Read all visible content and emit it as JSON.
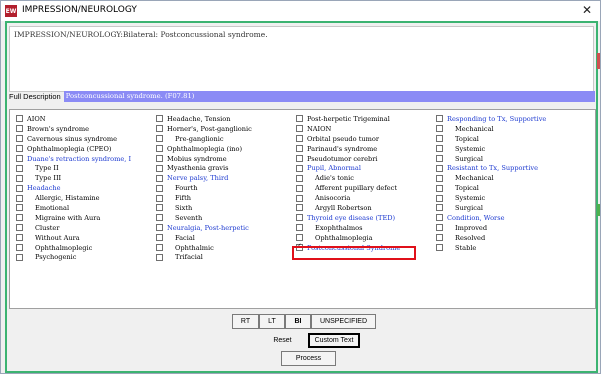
{
  "window": {
    "title": "IMPRESSION/NEUROLOGY",
    "app_icon_text": "EW",
    "close_glyph": "✕"
  },
  "impression_text": "IMPRESSION/NEUROLOGY:Bilateral: Postconcussional syndrome.",
  "full_description": {
    "label": "Full Description",
    "value": "Postconcussional syndrome. (F07.81)"
  },
  "columns": [
    {
      "items": [
        {
          "label": "AION",
          "style": "normal",
          "checked": false
        },
        {
          "label": "Brown's syndrome",
          "style": "normal",
          "checked": false
        },
        {
          "label": "Cavernous sinus syndrome",
          "style": "normal",
          "checked": false
        },
        {
          "label": "Ophthalmoplegia  (CPEO)",
          "style": "normal",
          "checked": false
        },
        {
          "label": "Duane's retraction syndrome, I",
          "style": "blue",
          "checked": false
        },
        {
          "label": "Type II",
          "style": "indent",
          "checked": false
        },
        {
          "label": "Type III",
          "style": "indent",
          "checked": false
        },
        {
          "label": "Headache",
          "style": "blue",
          "checked": false
        },
        {
          "label": "Allergic, Histamine",
          "style": "indent",
          "checked": false
        },
        {
          "label": "Emotional",
          "style": "indent",
          "checked": false
        },
        {
          "label": "Migraine with Aura",
          "style": "indent",
          "checked": false
        },
        {
          "label": "Cluster",
          "style": "indent2",
          "checked": false
        },
        {
          "label": "Without Aura",
          "style": "indent2",
          "checked": false
        },
        {
          "label": "Ophthalmoplegic",
          "style": "indent2",
          "checked": false
        },
        {
          "label": "Psychogenic",
          "style": "indent",
          "checked": false
        }
      ]
    },
    {
      "items": [
        {
          "label": "Headache, Tension",
          "style": "normal",
          "checked": false
        },
        {
          "label": "Horner's, Post-ganglionic",
          "style": "normal",
          "checked": false
        },
        {
          "label": "Pre-ganglionic",
          "style": "indent",
          "checked": false
        },
        {
          "label": "Ophthalmoplegia (ino)",
          "style": "normal",
          "checked": false
        },
        {
          "label": "Mobius syndrome",
          "style": "normal",
          "checked": false
        },
        {
          "label": "Myasthenia gravis",
          "style": "normal",
          "checked": false
        },
        {
          "label": "Nerve palsy, Third",
          "style": "blue",
          "checked": false
        },
        {
          "label": "Fourth",
          "style": "indent",
          "checked": false
        },
        {
          "label": "Fifth",
          "style": "indent",
          "checked": false
        },
        {
          "label": "Sixth",
          "style": "indent",
          "checked": false
        },
        {
          "label": "Seventh",
          "style": "indent",
          "checked": false
        },
        {
          "label": "Neuralgia, Post-herpetic",
          "style": "blue",
          "checked": false
        },
        {
          "label": "Facial",
          "style": "indent",
          "checked": false
        },
        {
          "label": "Ophthalmic",
          "style": "indent",
          "checked": false
        },
        {
          "label": "Trifacial",
          "style": "indent",
          "checked": false
        }
      ]
    },
    {
      "items": [
        {
          "label": "Post-herpetic Trigeminal",
          "style": "normal",
          "checked": false
        },
        {
          "label": "NAION",
          "style": "normal",
          "checked": false
        },
        {
          "label": "Orbital pseudo tumor",
          "style": "normal",
          "checked": false
        },
        {
          "label": "Parinaud's syndrome",
          "style": "normal",
          "checked": false
        },
        {
          "label": "Pseudotumor cerebri",
          "style": "normal",
          "checked": false
        },
        {
          "label": "Pupil, Abnormal",
          "style": "blue",
          "checked": false
        },
        {
          "label": "Adie's tonic",
          "style": "indent",
          "checked": false
        },
        {
          "label": "Afferent pupillary defect",
          "style": "indent",
          "checked": false
        },
        {
          "label": "Anisocoria",
          "style": "indent",
          "checked": false
        },
        {
          "label": "Argyll Robertson",
          "style": "indent",
          "checked": false
        },
        {
          "label": "Thyroid eye disease (TED)",
          "style": "blue",
          "checked": false
        },
        {
          "label": "Exophthalmos",
          "style": "indent",
          "checked": false
        },
        {
          "label": "Ophthalmoplegia",
          "style": "indent",
          "checked": false
        },
        {
          "label": "Postconcussional Syndrome",
          "style": "blue",
          "checked": true
        }
      ]
    },
    {
      "items": [
        {
          "label": "Responding to Tx, Supportive",
          "style": "blue",
          "checked": false
        },
        {
          "label": "Mechanical",
          "style": "indent",
          "checked": false
        },
        {
          "label": "Topical",
          "style": "indent",
          "checked": false
        },
        {
          "label": "Systemic",
          "style": "indent",
          "checked": false
        },
        {
          "label": "Surgical",
          "style": "indent",
          "checked": false
        },
        {
          "label": "Resistant to Tx, Supportive",
          "style": "blue",
          "checked": false
        },
        {
          "label": "Mechanical",
          "style": "indent",
          "checked": false
        },
        {
          "label": "Topical",
          "style": "indent",
          "checked": false
        },
        {
          "label": "Systemic",
          "style": "indent",
          "checked": false
        },
        {
          "label": "Surgical",
          "style": "indent",
          "checked": false
        },
        {
          "label": "Condition, Worse",
          "style": "blue",
          "checked": false
        },
        {
          "label": "Improved",
          "style": "indent",
          "checked": false
        },
        {
          "label": "Resolved",
          "style": "indent",
          "checked": false
        },
        {
          "label": "Stable",
          "style": "indent",
          "checked": false
        }
      ]
    }
  ],
  "laterality_buttons": [
    "RT",
    "LT",
    "BI",
    "UNSPECIFIED"
  ],
  "action_buttons": {
    "reset": "Reset",
    "custom_text": "Custom Text",
    "process": "Process"
  },
  "colors": {
    "accent_blue": "#1c39d0",
    "selection_bar": "#8b8bf5",
    "frame_green": "#3cb371",
    "highlight_red": "#e0101a"
  }
}
